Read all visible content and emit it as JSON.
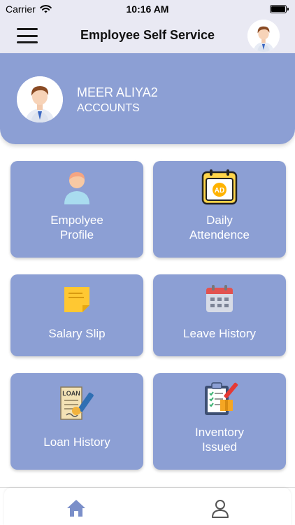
{
  "status_bar": {
    "carrier": "Carrier",
    "time": "10:16 AM"
  },
  "nav": {
    "title": "Employee Self Service"
  },
  "user": {
    "name": "MEER ALIYA2",
    "department": "ACCOUNTS"
  },
  "tiles": [
    {
      "line1": "Empolyee",
      "line2": "Profile",
      "icon": "user-icon"
    },
    {
      "line1": "Daily",
      "line2": "Attendence",
      "icon": "calendar-ad-icon"
    },
    {
      "line1": "Salary Slip",
      "line2": "",
      "icon": "sticky-note-icon"
    },
    {
      "line1": "Leave History",
      "line2": "",
      "icon": "calendar-icon"
    },
    {
      "line1": "Loan History",
      "line2": "",
      "icon": "loan-document-icon"
    },
    {
      "line1": "Inventory",
      "line2": "Issued",
      "icon": "clipboard-checklist-icon"
    }
  ],
  "tab_bar": {
    "items": [
      "home-icon",
      "profile-icon"
    ]
  },
  "colors": {
    "accent": "#8c9fd4",
    "nav_bg": "#e9e9f3",
    "active_tab": "#7b8fc9"
  }
}
